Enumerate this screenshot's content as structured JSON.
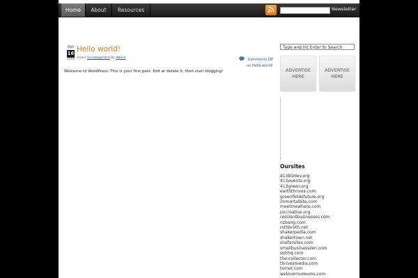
{
  "nav": {
    "items": [
      {
        "label": "Home",
        "active": true
      },
      {
        "label": "About",
        "active": false
      },
      {
        "label": "Resources",
        "active": false
      }
    ],
    "rss_icon": "rss-icon",
    "newsletter_label": "Newsletter"
  },
  "post": {
    "date": {
      "month": "Oct",
      "day": "16",
      "year": "2008"
    },
    "title": "Hello world!",
    "meta": {
      "under": "Under",
      "category": "Uncategorized",
      "by": "By",
      "author": "Admin"
    },
    "comments_line1": "Comments Off",
    "comments_line2": "on Hello world!",
    "body": "Welcome to WordPress. This is your first post. Edit or delete it, then start blogging!"
  },
  "sidebar": {
    "search_placeholder": "Type and hit Enter to Search",
    "ads": [
      {
        "line1": "ADVERTISE",
        "line2": "HERE"
      },
      {
        "line1": "ADVERTISE",
        "line2": "HERE"
      }
    ],
    "oursites_title": "Oursites",
    "sites": [
      "413bizdev.org",
      "413events.org",
      "413green.org",
      "earththrives.com",
      "greenfieldsfuture.org",
      "immortalbite.com",
      "meetmewhere.com",
      "pvcreative.org",
      "resilientbusinesses.com",
      "nzbang.com",
      "rothbroth.net",
      "shakerpedia.com",
      "shakertown.net",
      "shofarsites.com",
      "smallbusinesszen.com",
      "solrhq.com",
      "the-collector.com",
      "thrivesmedia.com",
      "tnmet.com",
      "welovemuseums.com"
    ]
  }
}
